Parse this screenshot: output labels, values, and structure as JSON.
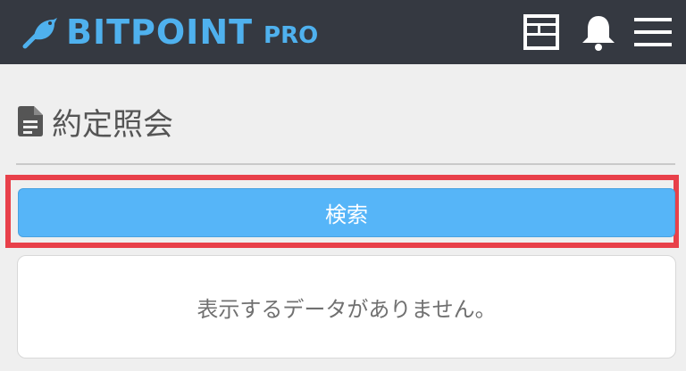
{
  "header": {
    "brand": "BITPOINT",
    "brand_suffix": "PRO",
    "icons": [
      "layout-board-icon",
      "bell-icon",
      "hamburger-menu-icon"
    ]
  },
  "page": {
    "title": "約定照会",
    "title_icon": "document-icon"
  },
  "search": {
    "button_label": "検索"
  },
  "results": {
    "empty_message": "表示するデータがありません。"
  },
  "colors": {
    "header_bg": "#353941",
    "brand": "#4fb1ee",
    "button": "#56b5f8",
    "highlight": "#e8404a",
    "page_bg": "#efefef"
  }
}
